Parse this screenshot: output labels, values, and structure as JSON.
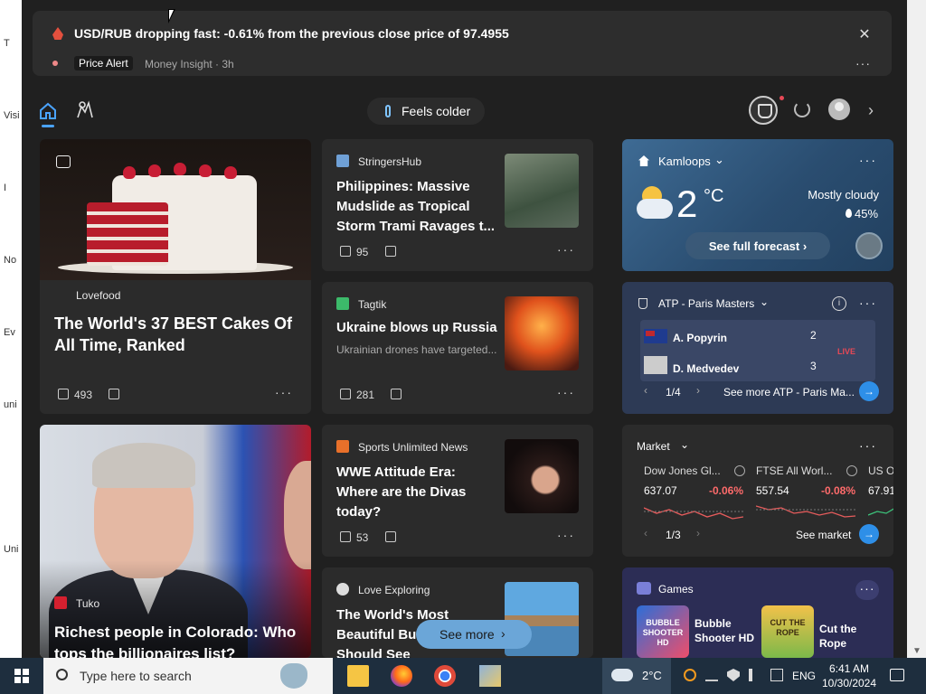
{
  "desktop_labels": [
    "T",
    "Visi",
    "I",
    "No",
    "Ev",
    "uni",
    "Uni"
  ],
  "alert": {
    "title": "USD/RUB dropping fast: -0.61% from the previous close price of 97.4955",
    "tag": "Price Alert",
    "meta": "Money Insight · 3h",
    "close": "✕",
    "more": "···"
  },
  "toolbar": {
    "feels": "Feels colder",
    "next": "›"
  },
  "cards": {
    "cake": {
      "source": "Lovefood",
      "headline": "The World's 37 BEST Cakes Of All Time, Ranked",
      "likes": "493"
    },
    "philippines": {
      "source": "StringersHub",
      "headline": "Philippines: Massive Mudslide as Tropical Storm Trami Ravages t...",
      "likes": "95"
    },
    "ukraine": {
      "source": "Tagtik",
      "headline": "Ukraine blows up Russia",
      "sub": "Ukrainian drones have targeted...",
      "likes": "281"
    },
    "wwe": {
      "source": "Sports Unlimited News",
      "headline": "WWE Attitude Era: Where are the Divas today?",
      "likes": "53"
    },
    "rich": {
      "source": "Tuko",
      "headline": "Richest people in Colorado: Who tops the billionaires list?"
    },
    "explore": {
      "source": "Love Exploring",
      "headline": "The World's Most Beautiful Bu... Everyone Should See"
    }
  },
  "weather": {
    "location": "Kamloops",
    "temp": "2",
    "unit": "°C",
    "condition": "Mostly cloudy",
    "precip": "45%",
    "forecast_btn": "See full forecast ›"
  },
  "sports": {
    "title": "ATP - Paris Masters",
    "player1": "A. Popyrin",
    "score1": "2",
    "player2": "D. Medvedev",
    "score2": "3",
    "live": "LIVE",
    "pager": "1/4",
    "more": "See more ATP - Paris Ma..."
  },
  "market": {
    "title": "Market",
    "stocks": [
      {
        "name": "Dow Jones Gl...",
        "value": "637.07",
        "change": "-0.06%"
      },
      {
        "name": "FTSE All Worl...",
        "value": "557.54",
        "change": "-0.08%"
      },
      {
        "name": "US O",
        "value": "67.91",
        "change": ""
      }
    ],
    "pager": "1/3",
    "more": "See market"
  },
  "games": {
    "title": "Games",
    "game1_name": "Bubble Shooter HD",
    "game2_name": "Cut the Rope",
    "game1_tile": "BUBBLE SHOOTER HD",
    "game2_tile": "CUT THE ROPE"
  },
  "see_more": "See more",
  "taskbar": {
    "search_placeholder": "Type here to search",
    "weather_temp": "2°C",
    "lang": "ENG",
    "time": "6:41 AM",
    "date": "10/30/2024"
  },
  "colors": {
    "accent": "#2e8fe8",
    "negative": "#ff6b6b",
    "panel_bg": "#202020",
    "card_bg": "#2b2b2b"
  }
}
